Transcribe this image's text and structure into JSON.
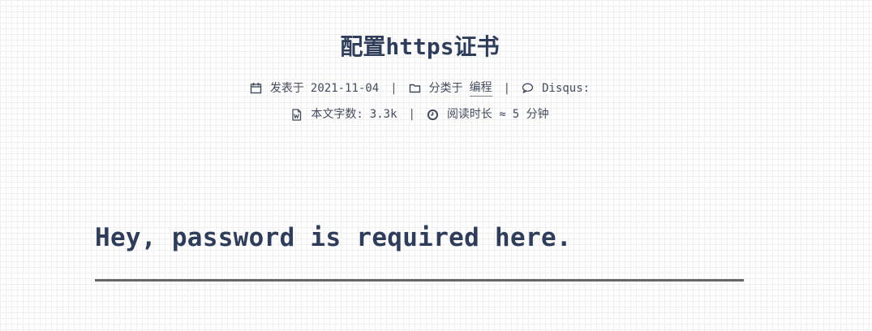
{
  "post": {
    "title": "配置https证书",
    "meta": {
      "posted_label": "发表于",
      "posted_date": "2021-11-04",
      "category_label": "分类于",
      "category_value": "编程",
      "comments_label": "Disqus:",
      "wordcount_label": "本文字数:",
      "wordcount_value": "3.3k",
      "readtime_label": "阅读时长 ≈",
      "readtime_value": "5 分钟",
      "separator": "|"
    }
  },
  "password": {
    "prompt": "Hey, password is required here.",
    "placeholder": ""
  },
  "icons": {
    "calendar": "calendar-icon",
    "folder": "folder-icon",
    "comment": "comment-icon",
    "file_word": "file-word-icon",
    "clock": "clock-icon"
  }
}
